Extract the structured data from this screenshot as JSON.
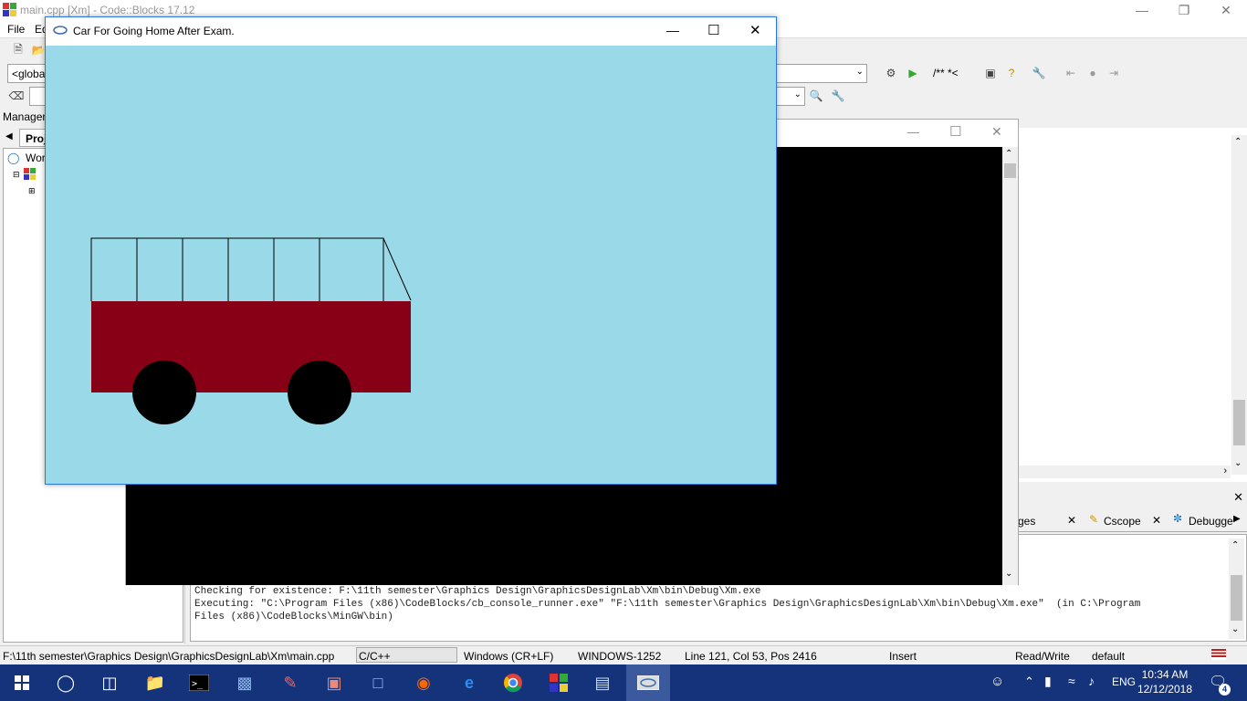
{
  "codeblocks": {
    "title": "main.cpp [Xm] - Code::Blocks 17.12",
    "menu": [
      "File",
      "Ed"
    ],
    "scope_combo": "<global",
    "management_label": "Managem",
    "tree": {
      "tab": "Proj",
      "workspace": "Wor"
    },
    "tabs_bottom": [
      "ges",
      "Cscope",
      "Debugge"
    ],
    "log_lines": [
      "Checking for existence: F:\\11th semester\\Graphics Design\\GraphicsDesignLab\\Xm\\bin\\Debug\\Xm.exe",
      "Executing: \"C:\\Program Files (x86)\\CodeBlocks/cb_console_runner.exe\" \"F:\\11th semester\\Graphics Design\\GraphicsDesignLab\\Xm\\bin\\Debug\\Xm.exe\"  (in C:\\Program",
      "Files (x86)\\CodeBlocks\\MinGW\\bin)"
    ],
    "status": {
      "path": "F:\\11th semester\\Graphics Design\\GraphicsDesignLab\\Xm\\main.cpp",
      "lang": "C/C++",
      "eol": "Windows (CR+LF)",
      "encoding": "WINDOWS-1252",
      "position": "Line 121, Col 53, Pos 2416",
      "mode": "Insert",
      "access": "Read/Write",
      "profile": "default"
    }
  },
  "graphics_window": {
    "title": "Car For Going Home After Exam."
  },
  "taskbar": {
    "language": "ENG",
    "time": "10:34 AM",
    "date": "12/12/2018",
    "notifications": "4"
  },
  "colors": {
    "sky": "#99d9e8",
    "bus_body": "#880015",
    "wheel": "#000000",
    "taskbar": "#14337a"
  }
}
